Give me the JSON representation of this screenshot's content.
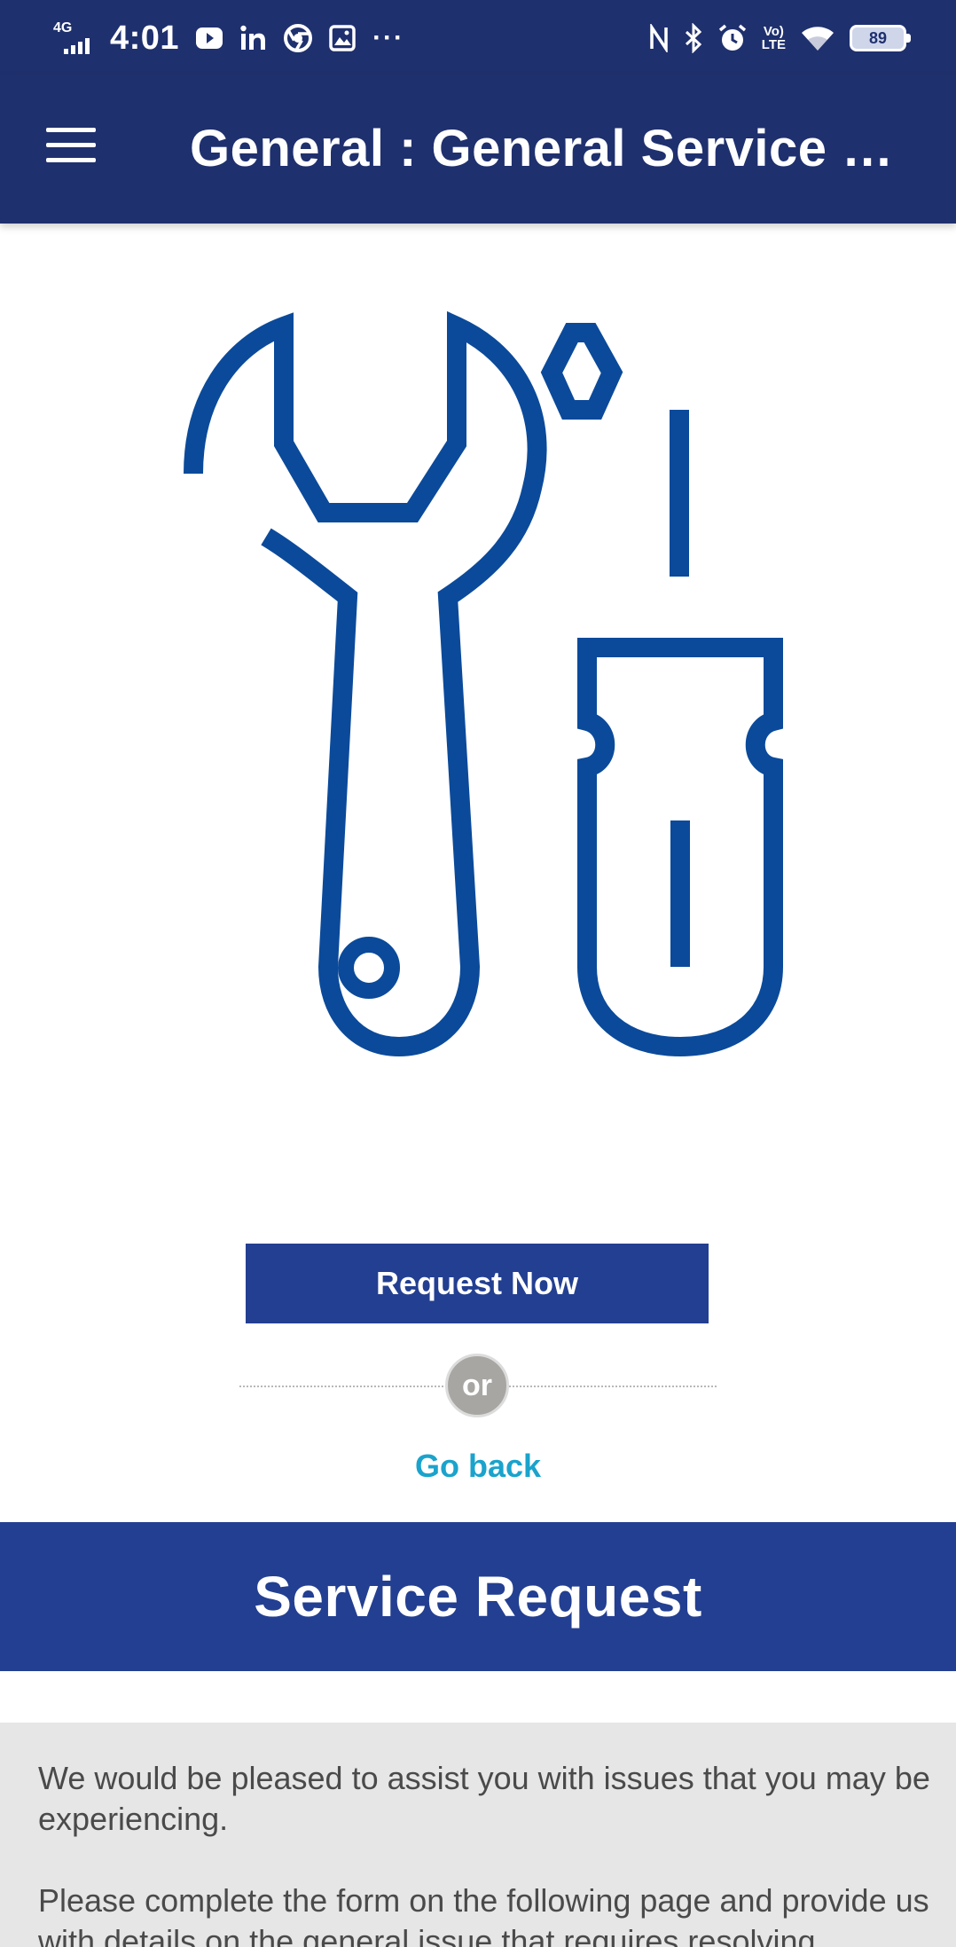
{
  "status_bar": {
    "network": "4G",
    "time": "4:01",
    "left_icons": [
      "youtube-icon",
      "linkedin-icon",
      "chrome-icon",
      "gallery-icon"
    ],
    "more": "···",
    "right_icons": [
      "nfc-icon",
      "bluetooth-icon",
      "alarm-icon",
      "volte-icon",
      "wifi-icon"
    ],
    "volte_top": "Vo)",
    "volte_bottom": "LTE",
    "battery": "89"
  },
  "app_bar": {
    "title": "General : General Service Request"
  },
  "hero": {
    "icon": "tools-icon",
    "color": "#0b4a9a"
  },
  "actions": {
    "request_label": "Request Now",
    "or_label": "or",
    "back_label": "Go back"
  },
  "section": {
    "title": "Service Request"
  },
  "info": {
    "line1a": "We would be pleased to assist you with issues that you may be",
    "line1b": "experiencing.",
    "line2a": "Please complete the form on the following page and provide us",
    "line2b": "with details on the general issue that requires resolving."
  },
  "colors": {
    "header": "#1f306e",
    "primary": "#233f91",
    "link": "#1aa3cc",
    "panel": "#e6e6e6"
  }
}
